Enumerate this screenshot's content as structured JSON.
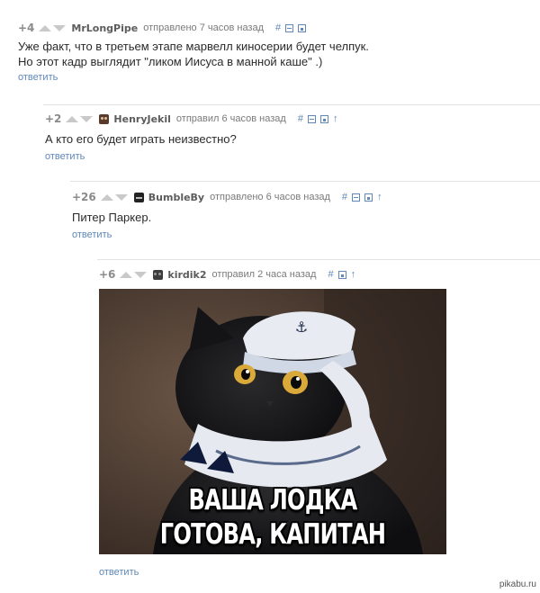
{
  "comments": [
    {
      "score": "+4",
      "author": "MrLongPipe",
      "time": "отправлено 7 часов назад",
      "tools": [
        "#",
        "⊟",
        "▣"
      ],
      "lines": [
        "Уже факт, что в третьем этапе марвелл киносерии будет челпук.",
        "Но этот кадр выглядит \"ликом Иисуса в манной каше\" .)"
      ],
      "reply": "ответить"
    },
    {
      "score": "+2",
      "author": "HenryJekil",
      "time": "отправил 6 часов назад",
      "tools": [
        "#",
        "⊟",
        "▣",
        "↑"
      ],
      "lines": [
        "А кто его будет играть неизвестно?"
      ],
      "reply": "ответить"
    },
    {
      "score": "+26",
      "author": "BumbleBy",
      "time": "отправлено 6 часов назад",
      "tools": [
        "#",
        "⊟",
        "▣",
        "↑"
      ],
      "lines": [
        "Питер Паркер."
      ],
      "reply": "ответить"
    },
    {
      "score": "+6",
      "author": "kirdik2",
      "time": "отправил 2 часа назад",
      "tools": [
        "#",
        "▣",
        "↑"
      ],
      "lines": [],
      "reply": "ответить",
      "image_caption": [
        "ВАША ЛОДКА",
        "ГОТОВА, КАПИТАН"
      ]
    }
  ],
  "watermark": "pikabu.ru",
  "colors": {
    "link": "#5f87b7",
    "score": "#8a8a8a",
    "text": "#2b2b2b"
  }
}
